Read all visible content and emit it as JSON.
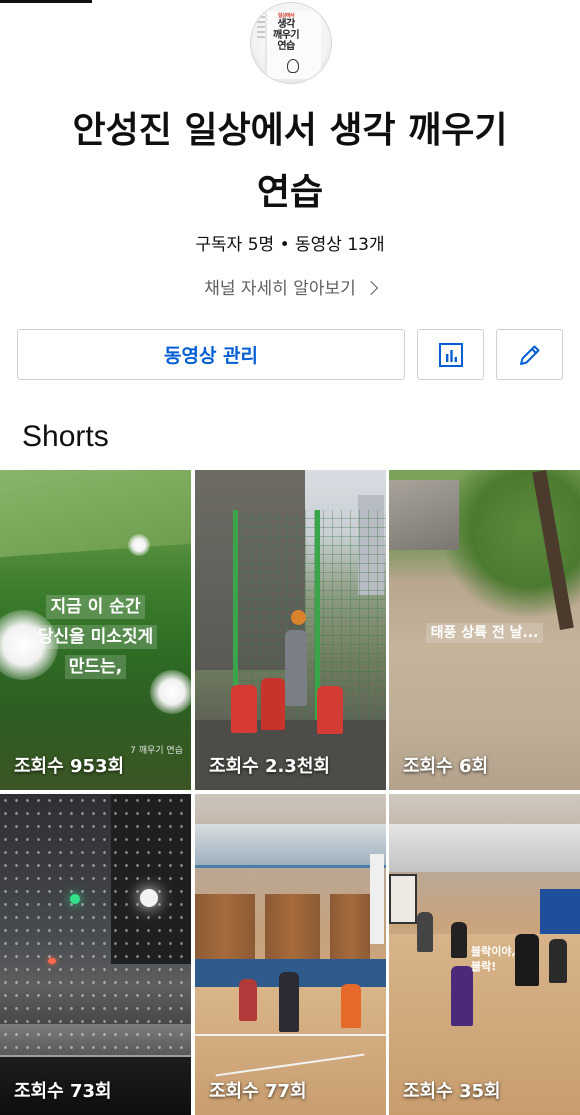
{
  "channel": {
    "name_line1": "안성진 일상에서 생각 깨우기",
    "name_line2": "연습",
    "stats": "구독자 5명 • 동영상 13개",
    "about_label": "채널 자세히 알아보기",
    "avatar_text": "생각\n깨우기\n연습"
  },
  "actions": {
    "manage_videos": "동영상 관리",
    "analytics_icon": "bar-chart-icon",
    "edit_icon": "pencil-icon"
  },
  "shorts": {
    "section_title": "Shorts",
    "items": [
      {
        "views": "조회수 953회",
        "caption_lines": [
          "지금 이 순간",
          "당신을 미소짓게",
          "만드는,"
        ],
        "watermark": "7 깨우기 연습"
      },
      {
        "views": "조회수 2.3천회"
      },
      {
        "views": "조회수 6회",
        "caption": "태풍 상륙 전 날..."
      },
      {
        "views": "조회수 73회"
      },
      {
        "views": "조회수 77회"
      },
      {
        "views": "조회수 35회",
        "caption_lines": [
          "블락이야,",
          "블락!"
        ]
      }
    ]
  },
  "colors": {
    "accent_blue": "#065fd4",
    "text_primary": "#0f0f0f",
    "text_secondary": "#606060",
    "border": "#d0d0d0"
  }
}
